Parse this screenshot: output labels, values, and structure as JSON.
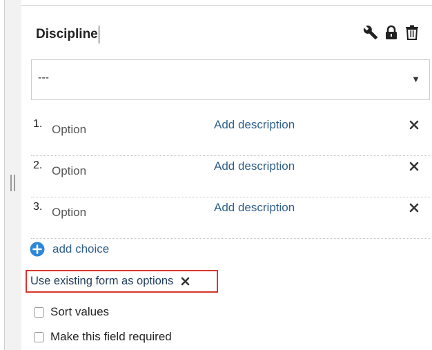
{
  "field": {
    "title": "Discipline",
    "tools": [
      "wrench-icon",
      "lock-icon",
      "trash-icon"
    ]
  },
  "select": {
    "value": "---",
    "arrow": "▼"
  },
  "options": [
    {
      "number": "1.",
      "label": "Option",
      "description_link": "Add description"
    },
    {
      "number": "2.",
      "label": "Option",
      "description_link": "Add description"
    },
    {
      "number": "3.",
      "label": "Option",
      "description_link": "Add description"
    }
  ],
  "add_choice": {
    "label": "add choice"
  },
  "use_existing": {
    "label": "Use existing form as options"
  },
  "checkboxes": {
    "sort_values": {
      "label": "Sort values",
      "checked": false
    },
    "required": {
      "label": "Make this field required",
      "checked": false
    }
  },
  "colors": {
    "link": "#2f5f8a",
    "add_icon": "#2f86d8",
    "highlight_border": "#d9342b",
    "text": "#222222"
  }
}
